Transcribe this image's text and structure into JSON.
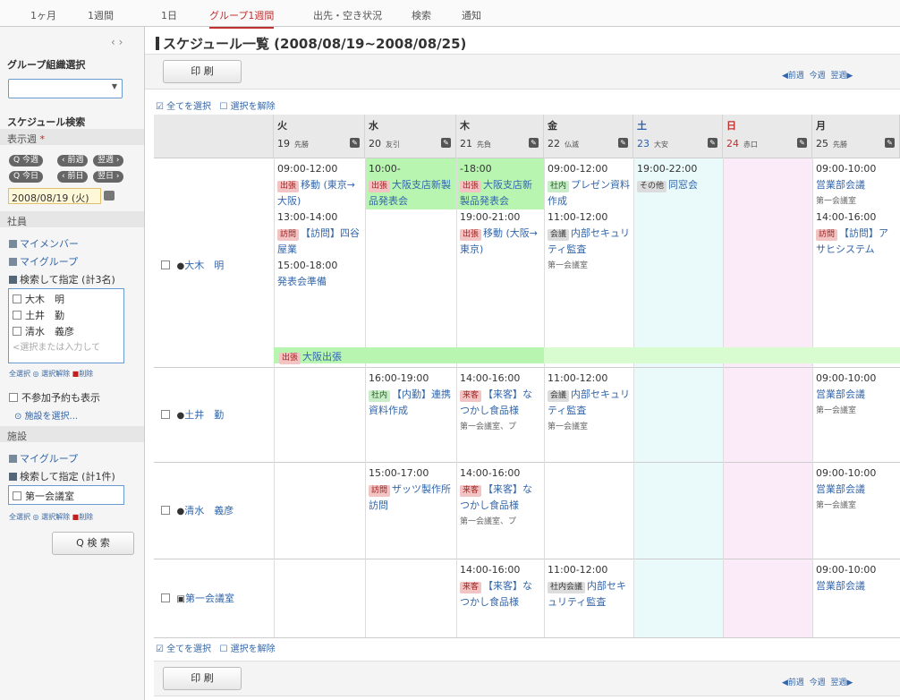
{
  "tabs": [
    "1ヶ月",
    "1週間",
    "1日",
    "グループ1週間",
    "出先・空き状況",
    "検索",
    "通知"
  ],
  "sidebar": {
    "group_select_title": "グループ組織選択",
    "search_title": "スケジュール検索",
    "display_week_label": "表示週",
    "btn_this_week": "今週",
    "btn_prev_week": "前週",
    "btn_next_week": "翌週",
    "btn_today": "今日",
    "btn_prev_day": "前日",
    "btn_next_day": "翌日",
    "date_value": "2008/08/19 (火)",
    "section_staff": "社員",
    "my_members": "マイメンバー",
    "my_groups": "マイグループ",
    "search_specify_staff": "検索して指定 (計3名)",
    "staff": [
      "大木　明",
      "土井　勤",
      "清水　義彦"
    ],
    "staff_placeholder": "<選択または入力して",
    "small_actions": [
      "全選択",
      "選択解除",
      "削除"
    ],
    "show_unconfirmed": "不参加予約も表示",
    "facility_select_link": "施設を選択...",
    "section_facility": "施設",
    "facility_my_groups": "マイグループ",
    "search_specify_facility": "検索して指定 (計1件)",
    "facilities": [
      "第一会議室"
    ],
    "search_button": "Q 検 索"
  },
  "main": {
    "title": "スケジュール一覧 (2008/08/19~2008/08/25)",
    "print_button": "印 刷",
    "nav_prev": "◀前週",
    "nav_current": "今週",
    "nav_next": "翌週▶",
    "select_all": "全てを選択",
    "deselect_all": "選択を解除"
  },
  "days": [
    {
      "name": "火",
      "date": "19",
      "rokuyo": "先勝"
    },
    {
      "name": "水",
      "date": "20",
      "rokuyo": "友引"
    },
    {
      "name": "木",
      "date": "21",
      "rokuyo": "先負"
    },
    {
      "name": "金",
      "date": "22",
      "rokuyo": "仏滅"
    },
    {
      "name": "土",
      "date": "23",
      "rokuyo": "大安"
    },
    {
      "name": "日",
      "date": "24",
      "rokuyo": "赤口"
    },
    {
      "name": "月",
      "date": "25",
      "rokuyo": "先勝"
    }
  ],
  "rows": [
    {
      "name": "大木　明",
      "cells": [
        [
          "09:00-12:00",
          "[出張] 移動 (東京→大阪)",
          "13:00-14:00",
          "[訪問] 【訪問】四谷屋業",
          "15:00-18:00",
          "発表会準備"
        ],
        [
          "10:00-",
          "[出張] 大阪支店新製品発表会"
        ],
        [
          "-18:00",
          "[出張] 大阪支店新製品発表会",
          "19:00-21:00",
          "[出張] 移動 (大阪→東京)"
        ],
        [
          "09:00-12:00",
          "[社内] プレゼン資料作成",
          "11:00-12:00",
          "[会議] 内部セキュリティ監査",
          "第一会議室"
        ],
        [
          "19:00-22:00",
          "[その他] 同窓会"
        ],
        [],
        [
          "09:00-10:00",
          "営業部会議",
          "第一会議室",
          "14:00-16:00",
          "[訪問] 【訪問】アサヒシステム"
        ]
      ],
      "banner": "[出張] 大阪出張"
    },
    {
      "name": "土井　勤",
      "cells": [
        [],
        [
          "16:00-19:00",
          "[社内] 【内勤】連携資料作成"
        ],
        [
          "14:00-16:00",
          "[来客] 【来客】なつかし食品様",
          "第一会議室、プ"
        ],
        [
          "11:00-12:00",
          "[会議] 内部セキュリティ監査",
          "第一会議室"
        ],
        [],
        [],
        [
          "09:00-10:00",
          "営業部会議",
          "第一会議室"
        ]
      ]
    },
    {
      "name": "清水　義彦",
      "cells": [
        [],
        [
          "15:00-17:00",
          "[訪問] ザッツ製作所　訪問"
        ],
        [
          "14:00-16:00",
          "[来客] 【来客】なつかし食品様",
          "第一会議室、プ"
        ],
        [],
        [],
        [],
        [
          "09:00-10:00",
          "営業部会議",
          "第一会議室"
        ]
      ]
    },
    {
      "name": "第一会議室",
      "cells": [
        [],
        [],
        [
          "14:00-16:00",
          "[来客] 【来客】なつかし食品様"
        ],
        [
          "11:00-12:00",
          "[社内会議] 内部セキュリティ監査"
        ],
        [],
        [],
        [
          "09:00-10:00",
          "営業部会議"
        ]
      ]
    }
  ]
}
